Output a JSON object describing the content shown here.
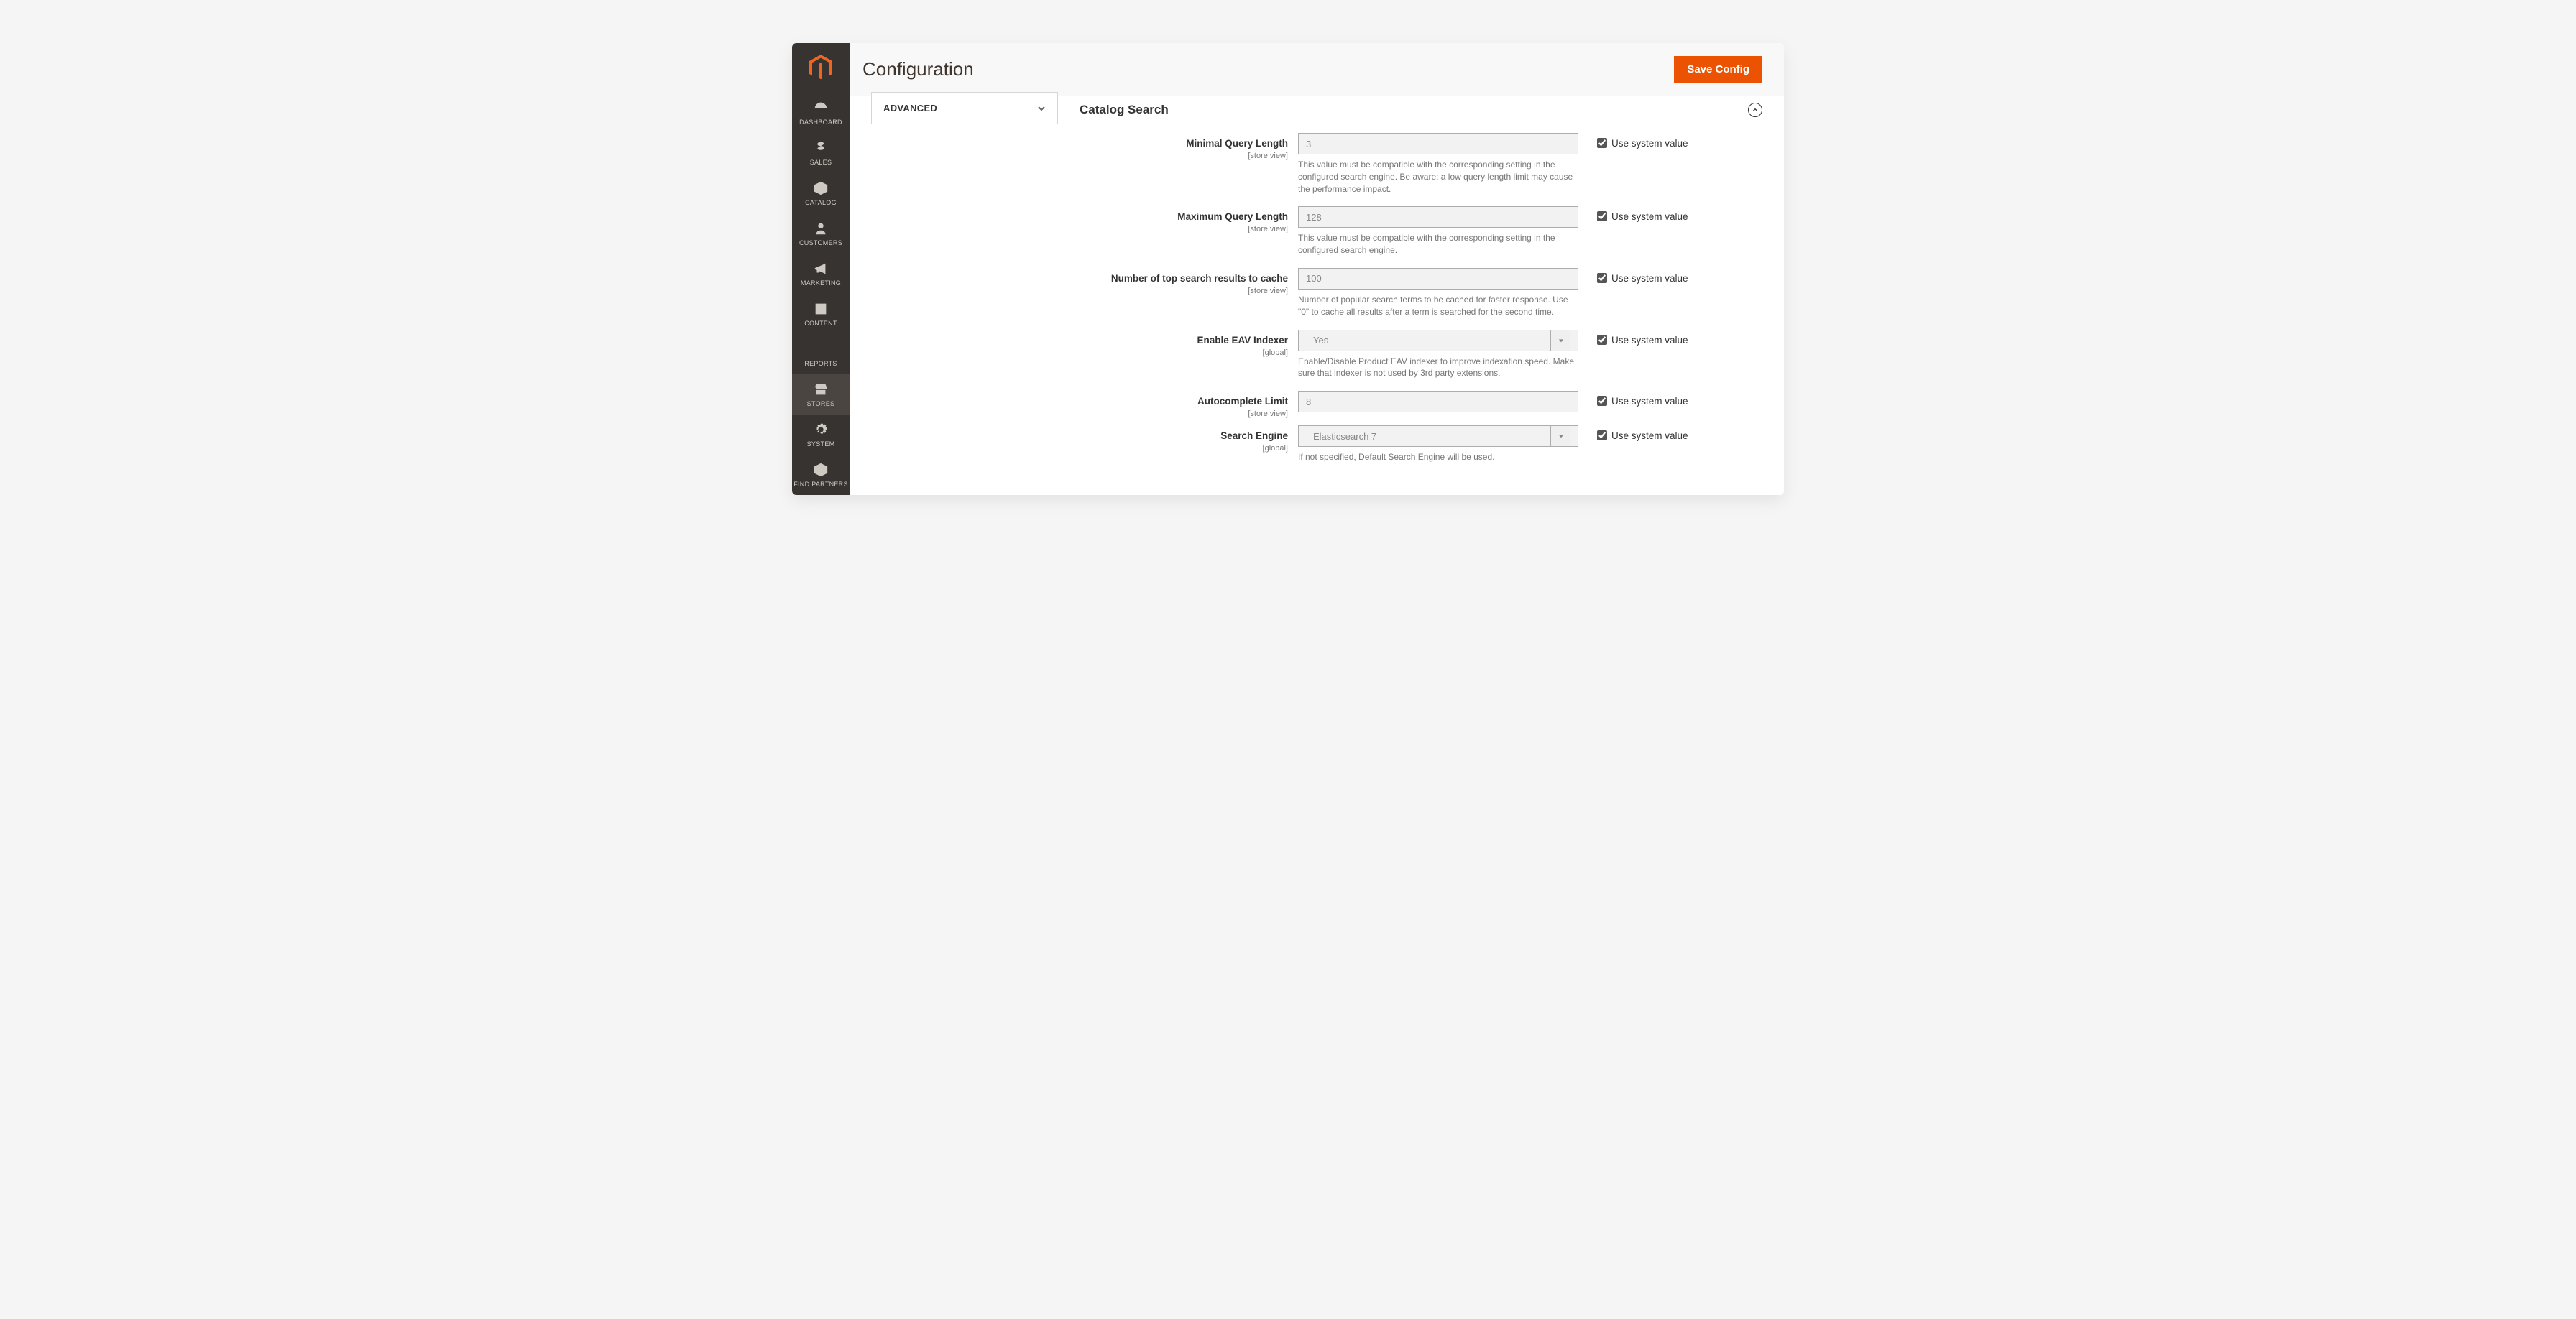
{
  "header": {
    "title": "Configuration",
    "save_label": "Save Config"
  },
  "sidebar": {
    "items": [
      {
        "label": "DASHBOARD"
      },
      {
        "label": "SALES"
      },
      {
        "label": "CATALOG"
      },
      {
        "label": "CUSTOMERS"
      },
      {
        "label": "MARKETING"
      },
      {
        "label": "CONTENT"
      },
      {
        "label": "REPORTS"
      },
      {
        "label": "STORES"
      },
      {
        "label": "SYSTEM"
      },
      {
        "label": "FIND PARTNERS"
      }
    ],
    "active_index": 7
  },
  "config_nav": {
    "label": "ADVANCED"
  },
  "section": {
    "title": "Catalog Search"
  },
  "system_value_label": "Use system value",
  "fields": [
    {
      "label": "Minimal Query Length",
      "scope": "[store view]",
      "type": "text",
      "value": "3",
      "help": "This value must be compatible with the corresponding setting in the configured search engine. Be aware: a low query length limit may cause the performance impact.",
      "use_system": true
    },
    {
      "label": "Maximum Query Length",
      "scope": "[store view]",
      "type": "text",
      "value": "128",
      "help": "This value must be compatible with the corresponding setting in the configured search engine.",
      "use_system": true
    },
    {
      "label": "Number of top search results to cache",
      "scope": "[store view]",
      "type": "text",
      "value": "100",
      "help": "Number of popular search terms to be cached for faster response. Use \"0\" to cache all results after a term is searched for the second time.",
      "use_system": true
    },
    {
      "label": "Enable EAV Indexer",
      "scope": "[global]",
      "type": "select",
      "value": "Yes",
      "help": "Enable/Disable Product EAV indexer to improve indexation speed. Make sure that indexer is not used by 3rd party extensions.",
      "use_system": true
    },
    {
      "label": "Autocomplete Limit",
      "scope": "[store view]",
      "type": "text",
      "value": "8",
      "help": "",
      "use_system": true
    },
    {
      "label": "Search Engine",
      "scope": "[global]",
      "type": "select",
      "value": "Elasticsearch 7",
      "help": "If not specified, Default Search Engine will be used.",
      "use_system": true
    }
  ]
}
